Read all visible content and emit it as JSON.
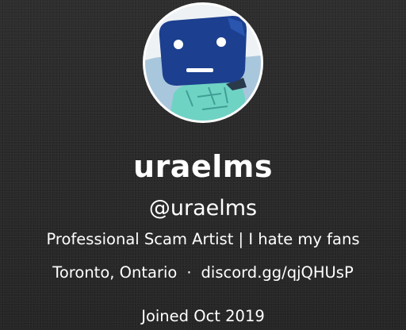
{
  "profile": {
    "display_name": "uraelms",
    "handle": "@uraelms",
    "bio": "Professional Scam Artist | I hate my fans",
    "location": "Toronto, Ontario",
    "separator": "·",
    "link": "discord.gg/qjQHUsP",
    "joined": "Joined Oct 2019",
    "avatar_icon": "robot-avatar-icon"
  },
  "colors": {
    "background": "#2b2b2b",
    "text": "#ffffff",
    "avatar_head": "#1c3f8f",
    "avatar_body": "#6fd3c4",
    "avatar_sky": "#a9c7dc"
  }
}
